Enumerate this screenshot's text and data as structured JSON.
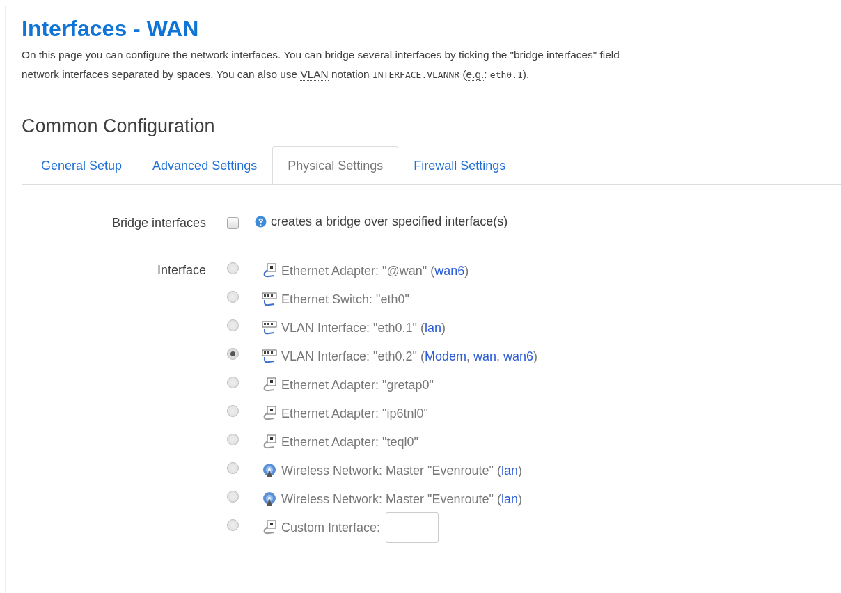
{
  "title": "Interfaces - WAN",
  "description": [
    [
      {
        "kind": "text",
        "text": "On this page you can configure the network interfaces. You can bridge several interfaces by ticking the \"bridge interfaces\" field"
      }
    ],
    [
      {
        "kind": "text",
        "text": "network interfaces separated by spaces. You can also use "
      },
      {
        "kind": "abbr",
        "text": "VLAN"
      },
      {
        "kind": "text",
        "text": " notation "
      },
      {
        "kind": "code",
        "text": "INTERFACE.VLANNR"
      },
      {
        "kind": "text",
        "text": " ("
      },
      {
        "kind": "abbr",
        "text": "e.g."
      },
      {
        "kind": "text",
        "text": ": "
      },
      {
        "kind": "code",
        "text": "eth0.1"
      },
      {
        "kind": "text",
        "text": ")."
      }
    ]
  ],
  "section_title": "Common Configuration",
  "tabs": [
    {
      "label": "General Setup",
      "selected": false
    },
    {
      "label": "Advanced Settings",
      "selected": false
    },
    {
      "label": "Physical Settings",
      "selected": true
    },
    {
      "label": "Firewall Settings",
      "selected": false
    }
  ],
  "bridge": {
    "label": "Bridge interfaces",
    "checked": false,
    "help": "creates a bridge over specified interface(s)"
  },
  "interface": {
    "label": "Interface",
    "options": [
      {
        "kind": "adapter",
        "label": "Ethernet Adapter: \"@wan\"",
        "networks": [
          {
            "kind": "punct",
            "text": "("
          },
          {
            "kind": "link",
            "text": "wan6"
          },
          {
            "kind": "punct",
            "text": ")"
          }
        ],
        "connected": true,
        "selected": false
      },
      {
        "kind": "switch",
        "label": "Ethernet Switch: \"eth0\"",
        "connected": true,
        "selected": false
      },
      {
        "kind": "switch",
        "label": "VLAN Interface: \"eth0.1\"",
        "networks": [
          {
            "kind": "punct",
            "text": "("
          },
          {
            "kind": "link",
            "text": "lan"
          },
          {
            "kind": "punct",
            "text": ")"
          }
        ],
        "connected": true,
        "selected": false
      },
      {
        "kind": "switch",
        "label": "VLAN Interface: \"eth0.2\"",
        "networks": [
          {
            "kind": "punct",
            "text": "("
          },
          {
            "kind": "link",
            "text": "Modem"
          },
          {
            "kind": "punct",
            "text": ","
          },
          {
            "kind": "link",
            "text": "wan"
          },
          {
            "kind": "punct",
            "text": ","
          },
          {
            "kind": "link",
            "text": "wan6"
          },
          {
            "kind": "punct",
            "text": ")"
          }
        ],
        "connected": true,
        "selected": true
      },
      {
        "kind": "adapter",
        "label": "Ethernet Adapter: \"gretap0\"",
        "connected": false,
        "selected": false
      },
      {
        "kind": "adapter",
        "label": "Ethernet Adapter: \"ip6tnl0\"",
        "connected": false,
        "selected": false
      },
      {
        "kind": "adapter",
        "label": "Ethernet Adapter: \"teql0\"",
        "connected": false,
        "selected": false
      },
      {
        "kind": "wifi",
        "label": "Wireless Network: Master \"Evenroute\"",
        "networks": [
          {
            "kind": "punct",
            "text": "("
          },
          {
            "kind": "link",
            "text": "lan"
          },
          {
            "kind": "punct",
            "text": ")"
          }
        ],
        "connected": true,
        "selected": false
      },
      {
        "kind": "wifi",
        "label": "Wireless Network: Master \"Evenroute\"",
        "networks": [
          {
            "kind": "punct",
            "text": "("
          },
          {
            "kind": "link",
            "text": "lan"
          },
          {
            "kind": "punct",
            "text": ")"
          }
        ],
        "connected": true,
        "selected": false
      },
      {
        "kind": "custom",
        "label": "Custom Interface:",
        "connected": false,
        "selected": false
      }
    ]
  }
}
